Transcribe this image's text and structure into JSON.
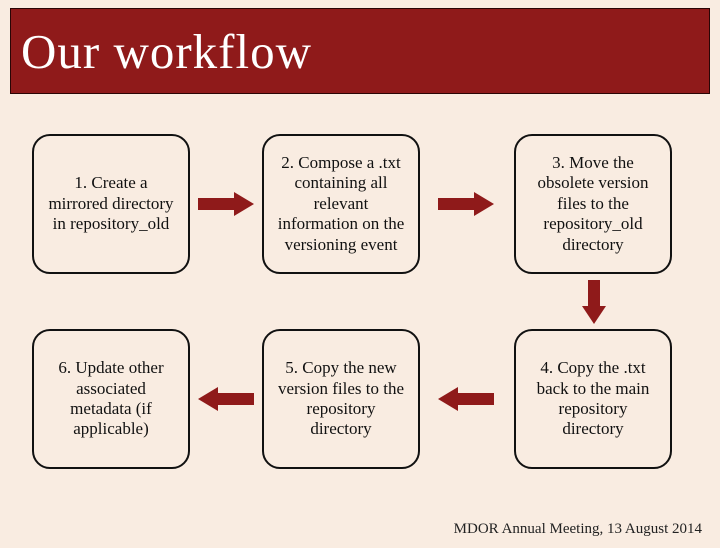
{
  "title": "Our workflow",
  "steps": {
    "s1": "1. Create a mirrored directory in repository_old",
    "s2": "2. Compose a .txt containing all relevant information on the versioning event",
    "s3": "3. Move the obsolete version files to the repository_old directory",
    "s4": "4. Copy the .txt back to the main repository directory",
    "s5": "5. Copy the new version files to the repository directory",
    "s6": "6. Update other associated metadata (if applicable)"
  },
  "footer": "MDOR Annual Meeting, 13 August 2014",
  "colors": {
    "accent": "#8f1a1a"
  }
}
